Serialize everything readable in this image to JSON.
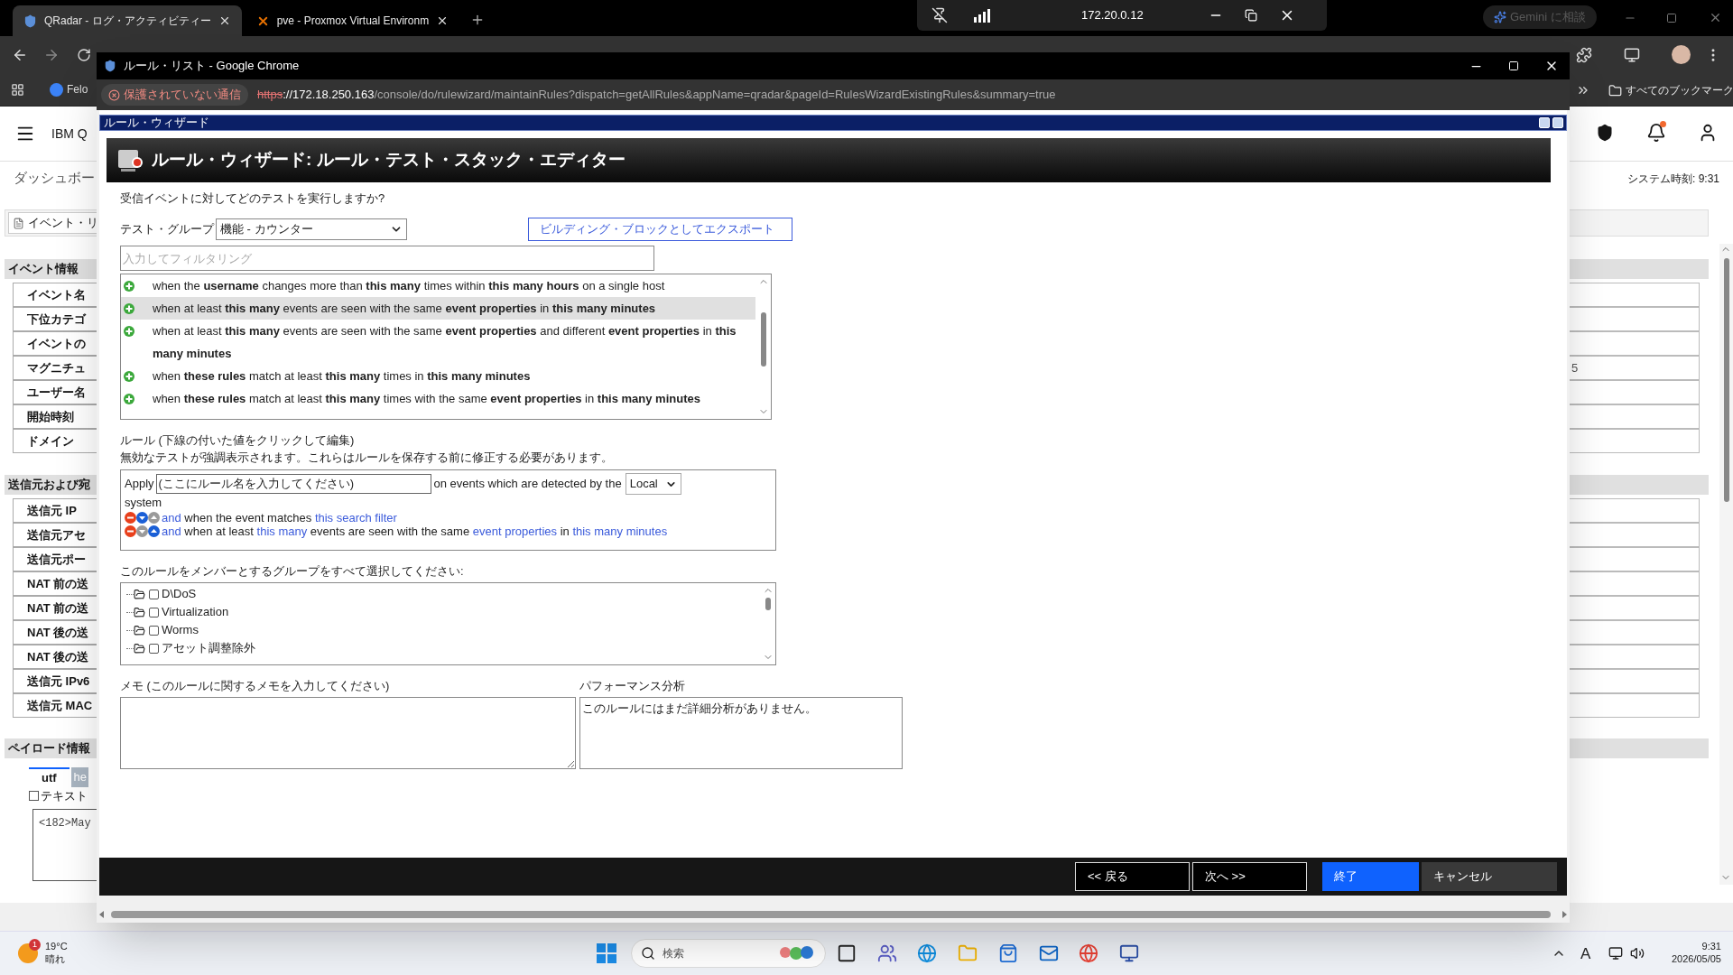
{
  "browser": {
    "tabs": [
      {
        "title": "QRadar - ログ・アクティビティー",
        "selected": true
      },
      {
        "title": "pve - Proxmox Virtual Environm",
        "selected": false
      }
    ],
    "assistant_button": "Gemini に相談",
    "bookmarks": [
      "Felo"
    ],
    "all_bookmarks": "すべてのブックマーク"
  },
  "remote_bar": {
    "host": "172.20.0.12"
  },
  "page": {
    "brand": "IBM Q",
    "nav": "ダッシュボー",
    "system_time": "システム時刻: 9:31",
    "toolbar_button": "イベント・リ",
    "sections": [
      {
        "title": "イベント情報",
        "rows": [
          {
            "label": "イベント名"
          },
          {
            "label": "下位カテゴ"
          },
          {
            "label": "イベントの"
          },
          {
            "label": "マグニチュ",
            "value": "5"
          },
          {
            "label": "ユーザー名"
          },
          {
            "label": "開始時刻"
          },
          {
            "label": "ドメイン"
          }
        ]
      },
      {
        "title": "送信元および宛",
        "rows": [
          {
            "label": "送信元 IP"
          },
          {
            "label": "送信元アセ"
          },
          {
            "label": "送信元ポー"
          },
          {
            "label": "NAT 前の送"
          },
          {
            "label": "NAT 前の送"
          },
          {
            "label": "NAT 後の送"
          },
          {
            "label": "NAT 後の送"
          },
          {
            "label": "送信元 IPv6"
          },
          {
            "label": "送信元 MAC"
          }
        ]
      }
    ],
    "payload": {
      "title": "ペイロード情報",
      "tabs": [
        {
          "label": "utf",
          "selected": true
        },
        {
          "label": "he",
          "selected": false
        }
      ],
      "checkbox": {
        "label": "テキスト",
        "checked": false
      },
      "content": "<182>May"
    }
  },
  "popup": {
    "window_title": "ルール・リスト - Google Chrome",
    "security": "保護されていない通信",
    "url": {
      "scheme": "https",
      "host": "://172.18.250.163",
      "path": "/console/do/rulewizard/maintainRules?dispatch=getAllRules&appName=qradar&pageId=RulesWizardExistingRules&summary=true"
    },
    "frame_title": "ルール・ウィザード",
    "heading": "ルール・ウィザード: ルール・テスト・スタック・エディター",
    "question": "受信イベントに対してどのテストを実行しますか?",
    "test_group": {
      "label": "テスト・グループ",
      "value": "機能 - カウンター"
    },
    "export_button": "ビルディング・ブロックとしてエクスポート",
    "filter": {
      "placeholder": "入力してフィルタリング"
    },
    "tests": [
      {
        "text": "when the **username** changes more than **this many** times within **this many hours** on a single host",
        "selected": false
      },
      {
        "text": "when at least **this many** events are seen with the same **event properties** in **this many minutes**",
        "selected": true
      },
      {
        "text": "when at least **this many** events are seen with the same **event properties** and different **event properties** in **this many minutes**",
        "selected": false
      },
      {
        "text": "when **these rules** match at least **this many** times in **this many minutes**",
        "selected": false
      },
      {
        "text": "when **these rules** match at least **this many** times with the same **event properties** in **this many minutes**",
        "selected": false
      }
    ],
    "rule": {
      "label": "ルール (下線の付いた値をクリックして編集)",
      "note": "無効なテストが強調表示されます。これらはルールを保存する前に修正する必要があります。",
      "apply": "Apply",
      "name_value": "(ここにルール名を入力してください)",
      "detected_by": "on events which are detected by the",
      "scope": "Local",
      "tail": "system",
      "clauses": [
        {
          "down_enabled": true,
          "up_enabled": false,
          "parts": [
            {
              "text": "and",
              "link": true
            },
            {
              "text": "when the event matches",
              "link": false
            },
            {
              "text": "this search filter",
              "link": true
            }
          ]
        },
        {
          "down_enabled": false,
          "up_enabled": true,
          "parts": [
            {
              "text": "and",
              "link": true
            },
            {
              "text": "when at least",
              "link": false
            },
            {
              "text": "this many",
              "link": true
            },
            {
              "text": "events are seen with the same",
              "link": false
            },
            {
              "text": "event properties",
              "link": true
            },
            {
              "text": "in",
              "link": false
            },
            {
              "text": "this many minutes",
              "link": true
            }
          ]
        }
      ]
    },
    "groups": {
      "label": "このルールをメンバーとするグループをすべて選択してください:",
      "items": [
        {
          "label": "D\\DoS",
          "checked": false
        },
        {
          "label": "Virtualization",
          "checked": false
        },
        {
          "label": "Worms",
          "checked": false
        },
        {
          "label": "アセット調整除外",
          "checked": false
        }
      ]
    },
    "memo": {
      "label": "メモ (このルールに関するメモを入力してください)"
    },
    "performance": {
      "label": "パフォーマンス分析",
      "text": "このルールにはまだ詳細分析がありません。"
    },
    "buttons": [
      {
        "label": "<< 戻る",
        "kind": "outline"
      },
      {
        "label": "次へ >>",
        "kind": "outline"
      },
      {
        "label": "終了",
        "kind": "primary"
      },
      {
        "label": "キャンセル",
        "kind": "secondary"
      }
    ]
  },
  "taskbar": {
    "weather": {
      "temp": "19°C",
      "condition": "晴れ",
      "badge": "1"
    },
    "search": "検索",
    "ime": "A",
    "time": "9:31",
    "date": "2026/05/05"
  }
}
